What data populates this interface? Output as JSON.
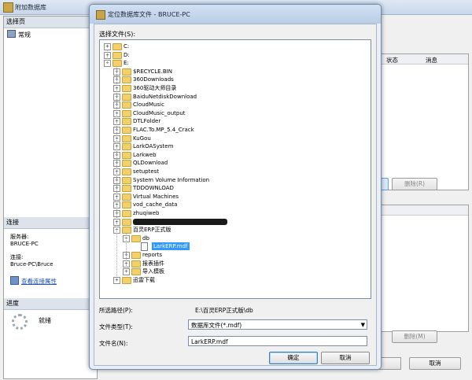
{
  "bg_window": {
    "title": "附加数据库",
    "select_page": "选择页",
    "general": "常规",
    "connection_header": "连接",
    "server_label": "服务器:",
    "server_value": "BRUCE-PC",
    "connection_label": "连接:",
    "connection_value": "Bruce-PC\\Bruce",
    "view_connection_link": "查看连接属性",
    "progress_header": "进度",
    "progress_status": "就绪",
    "col_status": "状态",
    "col_message": "消息",
    "remove_label": "删除(R)",
    "remove_label_bottom": "删除(M)",
    "cancel_label": "取消"
  },
  "dialog": {
    "title": "定位数据库文件 - BRUCE-PC",
    "select_file_label": "选择文件(S):",
    "tree": {
      "drives": [
        "C:",
        "D:",
        "E:"
      ],
      "e_children": [
        "$RECYCLE.BIN",
        "360Downloads",
        "360驱动大师目录",
        "BaiduNetdiskDownload",
        "CloudMusic",
        "CloudMusic_output",
        "DTLFolder",
        "FLAC.To.MP_5.4_Crack",
        "KuGou",
        "LarkOASystem",
        "Larkweb",
        "QLDownload",
        "setuptest",
        "System Volume Information",
        "TDDOWNLOAD",
        "Virtual Machines",
        "vod_cache_data",
        "zhuqiweb"
      ],
      "erp_folder": "百灵ERP正式版",
      "db_folder": "db",
      "selected_file": "LarkERP.mdf",
      "erp_children": [
        "reports",
        "报表插件",
        "导入模板"
      ],
      "last_folder": "迅雷下载"
    },
    "path_label": "所选路径(P):",
    "path_value": "E:\\百灵ERP正式版\\db",
    "filetype_label": "文件类型(T):",
    "filetype_value": "数据库文件(*.mdf)",
    "filename_label": "文件名(N):",
    "filename_value": "LarkERP.mdf",
    "ok_label": "确定",
    "cancel_label": "取消"
  }
}
